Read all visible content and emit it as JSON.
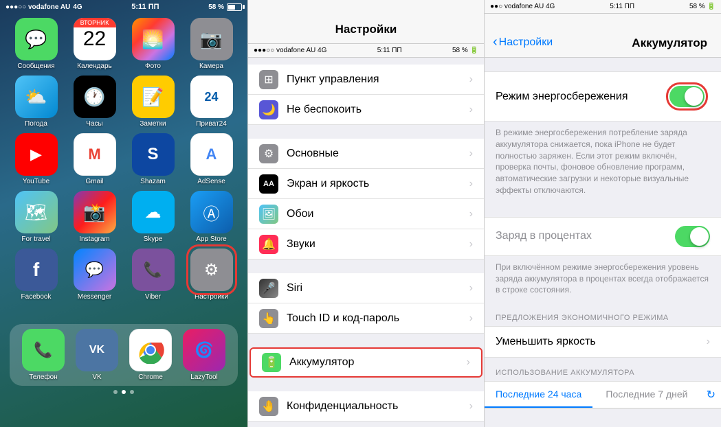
{
  "homescreen": {
    "status": {
      "carrier": "vodafone AU",
      "network": "4G",
      "time": "5:11 ПП",
      "battery": "58 %"
    },
    "apps_row1": [
      {
        "id": "messages",
        "label": "Сообщения",
        "icon": "💬",
        "bg": "bg-green"
      },
      {
        "id": "calendar",
        "label": "Календарь",
        "icon": "cal",
        "bg": "bg-calendar"
      },
      {
        "id": "photos",
        "label": "Фото",
        "icon": "🌅",
        "bg": "bg-photos"
      },
      {
        "id": "camera",
        "label": "Камера",
        "icon": "📷",
        "bg": "bg-gray"
      }
    ],
    "apps_row2": [
      {
        "id": "weather",
        "label": "Погода",
        "icon": "⛅",
        "bg": "bg-weather"
      },
      {
        "id": "clock",
        "label": "Часы",
        "icon": "🕐",
        "bg": "bg-clock"
      },
      {
        "id": "notes",
        "label": "Заметки",
        "icon": "📝",
        "bg": "bg-notes"
      },
      {
        "id": "privat",
        "label": "Приват24",
        "icon": "P24",
        "bg": "bg-privat"
      }
    ],
    "apps_row3": [
      {
        "id": "youtube",
        "label": "YouTube",
        "icon": "▶",
        "bg": "bg-youtube"
      },
      {
        "id": "gmail",
        "label": "Gmail",
        "icon": "✉",
        "bg": "bg-gmail"
      },
      {
        "id": "shazam",
        "label": "Shazam",
        "icon": "S",
        "bg": "bg-shazam"
      },
      {
        "id": "adsense",
        "label": "AdSense",
        "icon": "$",
        "bg": "bg-adsense"
      }
    ],
    "apps_row4": [
      {
        "id": "fortravel",
        "label": "For travel",
        "icon": "🗺",
        "bg": "bg-maps"
      },
      {
        "id": "instagram",
        "label": "Instagram",
        "icon": "📸",
        "bg": "bg-instagram"
      },
      {
        "id": "skype",
        "label": "Skype",
        "icon": "☁",
        "bg": "bg-skype"
      },
      {
        "id": "appstore",
        "label": "App Store",
        "icon": "A",
        "bg": "bg-appstore"
      }
    ],
    "apps_row5": [
      {
        "id": "facebook",
        "label": "Facebook",
        "icon": "f",
        "bg": "bg-facebook"
      },
      {
        "id": "messenger",
        "label": "Messenger",
        "icon": "⚡",
        "bg": "bg-messenger"
      },
      {
        "id": "viber",
        "label": "Viber",
        "icon": "📞",
        "bg": "bg-viber"
      },
      {
        "id": "settings",
        "label": "Настройки",
        "icon": "⚙",
        "bg": "bg-settings"
      }
    ],
    "dock": [
      {
        "id": "phone",
        "label": "Телефон",
        "icon": "📞",
        "bg": "bg-phone"
      },
      {
        "id": "vk",
        "label": "VK",
        "icon": "VK",
        "bg": "bg-vk"
      },
      {
        "id": "chrome",
        "label": "Chrome",
        "icon": "chrome",
        "bg": "bg-chrome"
      },
      {
        "id": "lazytool",
        "label": "LazyTool",
        "icon": "🌀",
        "bg": "bg-lazytool"
      }
    ]
  },
  "settings_panel": {
    "title": "Настройки",
    "items": [
      {
        "id": "control-center",
        "label": "Пункт управления",
        "icon_color": "#8e8e93",
        "icon": "⊞"
      },
      {
        "id": "do-not-disturb",
        "label": "Не беспокоить",
        "icon_color": "#5856d6",
        "icon": "🌙"
      },
      {
        "id": "general",
        "label": "Основные",
        "icon_color": "#8e8e93",
        "icon": "⚙"
      },
      {
        "id": "display",
        "label": "Экран и яркость",
        "icon_color": "#000",
        "icon": "AA"
      },
      {
        "id": "wallpaper",
        "label": "Обои",
        "icon_color": "#34aadc",
        "icon": "🖼"
      },
      {
        "id": "sounds",
        "label": "Звуки",
        "icon_color": "#ff2d55",
        "icon": "🔔"
      },
      {
        "id": "siri",
        "label": "Siri",
        "icon_color": "#000",
        "icon": "🎤"
      },
      {
        "id": "touchid",
        "label": "Touch ID и код-пароль",
        "icon_color": "#8e8e93",
        "icon": "👆"
      },
      {
        "id": "battery",
        "label": "Аккумулятор",
        "icon_color": "#4cd964",
        "icon": "🔋"
      },
      {
        "id": "privacy",
        "label": "Конфиденциальность",
        "icon_color": "#8e8e93",
        "icon": "🤚"
      }
    ]
  },
  "battery_panel": {
    "back_label": "Настройки",
    "title": "Аккумулятор",
    "power_saving_label": "Режим энергосбережения",
    "power_saving_on": true,
    "power_saving_description": "В режиме энергосбережения потребление заряда аккумулятора снижается, пока iPhone не будет полностью заряжен. Если этот режим включён, проверка почты, фоновое обновление программ, автоматические загрузки и некоторые визуальные эффекты отключаются.",
    "charge_percent_label": "Заряд в процентах",
    "charge_percent_on": true,
    "charge_percent_description": "При включённом режиме энергосбережения уровень заряда аккумулятора в процентах всегда отображается в строке состояния.",
    "eco_header": "ПРЕДЛОЖЕНИЯ ЭКОНОМИЧНОГО РЕЖИМА",
    "brightness_label": "Уменьшить яркость",
    "usage_header": "ИСПОЛЬЗОВАНИЕ АККУМУЛЯТОРА",
    "tab_24h": "Последние 24 часа",
    "tab_7d": "Последние 7 дней"
  }
}
